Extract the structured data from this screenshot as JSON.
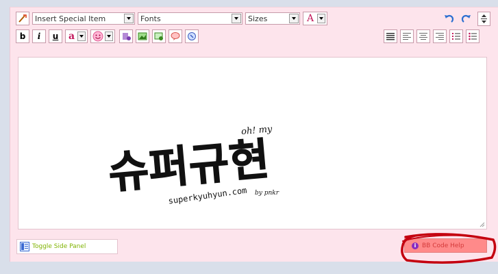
{
  "toolbar": {
    "special_item_label": "Insert Special Item",
    "fonts_label": "Fonts",
    "sizes_label": "Sizes",
    "font_color_glyph": "A",
    "bold_glyph": "b",
    "italic_glyph": "i",
    "underline_glyph": "u",
    "highlight_glyph": "a"
  },
  "content": {
    "logo_main": "슈퍼규현",
    "logo_tag": "oh! my",
    "logo_site": "superkyuhyun.com",
    "logo_by": "by pnkr"
  },
  "footer": {
    "toggle_label": "Toggle Side Panel",
    "bb_help_label": "BB Code Help",
    "bb_help_icon_glyph": "i"
  },
  "colors": {
    "panel_bg": "#fde4ec",
    "toggle_text": "#7fb300",
    "bb_help_bg": "#ff8a8a",
    "annotation": "#c4000f"
  }
}
